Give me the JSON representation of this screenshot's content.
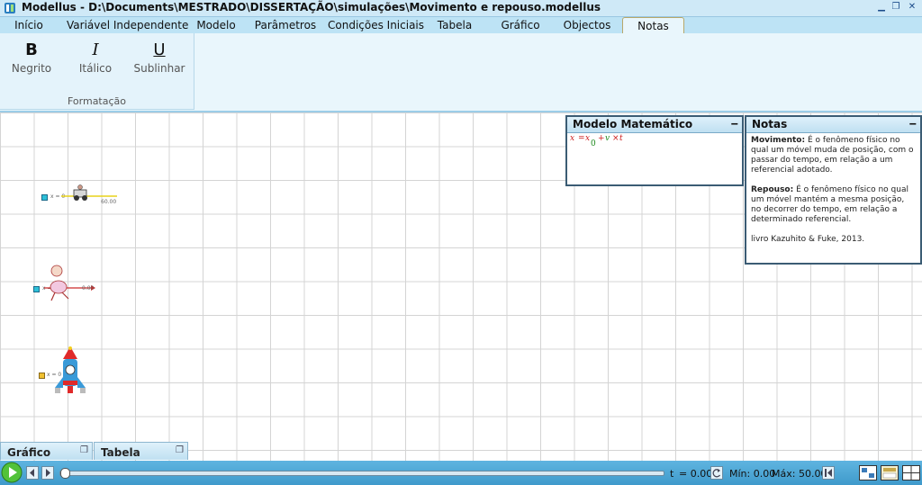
{
  "window": {
    "title": "Modellus - D:\\Documents\\MESTRADO\\DISSERTAÇÃO\\simulações\\Movimento e repouso.modellus"
  },
  "tabs": [
    {
      "label": "Início"
    },
    {
      "label": "Variável Independente"
    },
    {
      "label": "Modelo"
    },
    {
      "label": "Parâmetros"
    },
    {
      "label": "Condições Iniciais"
    },
    {
      "label": "Tabela"
    },
    {
      "label": "Gráfico"
    },
    {
      "label": "Objectos"
    },
    {
      "label": "Notas"
    }
  ],
  "ribbon": {
    "bold": {
      "glyph": "B",
      "label": "Negrito"
    },
    "italic": {
      "glyph": "I",
      "label": "Itálico"
    },
    "underline": {
      "glyph": "U",
      "label": "Sublinhar"
    },
    "group_label": "Formatação"
  },
  "canvas": {
    "car_label": "x = 0",
    "car_value": "60.00",
    "runner_label": "x = 0",
    "runner_value": "0.00",
    "rocket_label": "x = 0"
  },
  "model_panel": {
    "title": "Modelo Matemático",
    "minimize": "‒",
    "eq": {
      "x": "x",
      "eq": "=",
      "x0": "x",
      "sub0": "0",
      "plus": "+",
      "v": "v",
      "times": "×",
      "t": "t"
    },
    "colors": {
      "red": "#cc1a1a",
      "green": "#1e8a1e"
    }
  },
  "notes_panel": {
    "title": "Notas",
    "minimize": "‒",
    "p1_bold": "Movimento:",
    "p1_text": " É o fenômeno físico no qual um móvel muda de posição, com o passar do tempo, em relação a um referencial adotado.",
    "p2_bold": "Repouso:",
    "p2_text": " É o fenômeno físico no qual um móvel mantém a mesma posição, no decorrer do tempo, em relação a determinado referencial.",
    "p3_text": "livro Kazuhito & Fuke, 2013."
  },
  "minitabs": [
    {
      "label": "Gráfico"
    },
    {
      "label": "Tabela"
    }
  ],
  "statusbar": {
    "t_label": "t",
    "t_value": "= 0.00",
    "min_label": "Mín: 0.00",
    "max_label": "Máx: 50.00",
    "progress": 0
  },
  "accent": "#3f9acb"
}
